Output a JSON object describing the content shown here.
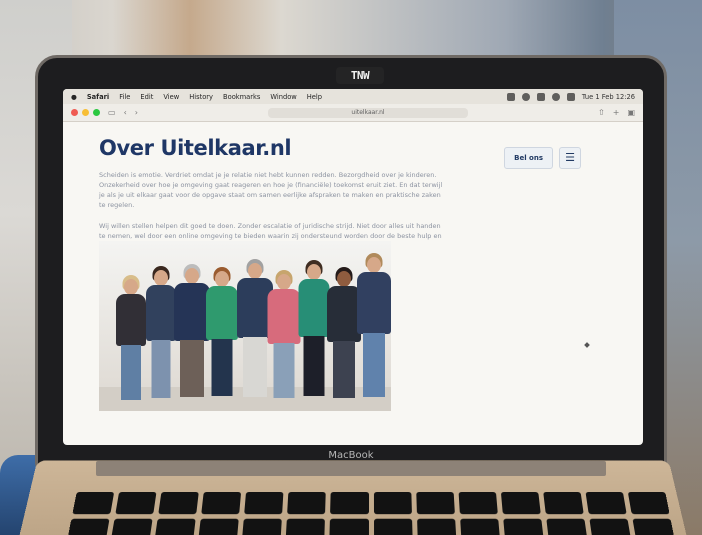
{
  "branding": {
    "camera": "TNW",
    "laptop": "MacBook"
  },
  "menubar": {
    "app": "Safari",
    "items": [
      "File",
      "Edit",
      "View",
      "History",
      "Bookmarks",
      "Window",
      "Help"
    ],
    "time": "Tue 1 Feb 12:26"
  },
  "browser": {
    "url": "uitelkaar.nl"
  },
  "website": {
    "title": "Over Uitelkaar.nl",
    "call_button": "Bel ons",
    "menu_icon": "☰",
    "paragraphs": [
      "Scheiden is emotie. Verdriet omdat je je relatie niet hebt kunnen redden. Bezorgdheid over je kinderen. Onzekerheid over hoe je omgeving gaat reageren en hoe je (financiële) toekomst eruit ziet. En dat terwijl je als je uit elkaar gaat voor de opgave staat om samen eerlijke afspraken te maken en praktische zaken te regelen.",
      "Wij willen stellen helpen dit goed te doen. Zonder escalatie of juridische strijd. Niet door alles uit handen te nemen, wel door een online omgeving te bieden waarin zij ondersteund worden door de beste hulp en informatie. Op die manier kunnen zij zelf de regie over hun scheidingsafspraken nemen."
    ]
  },
  "colors": {
    "brand_blue": "#1f3766",
    "muted_text": "#8c93a1",
    "screen_bg": "#f8f7f3"
  },
  "icons": [
    "apple-logo-icon",
    "reader-icon",
    "back-icon",
    "forward-icon",
    "shield-icon",
    "share-icon",
    "plus-icon",
    "tabs-icon",
    "menu-icon",
    "mouse-cursor-icon"
  ]
}
